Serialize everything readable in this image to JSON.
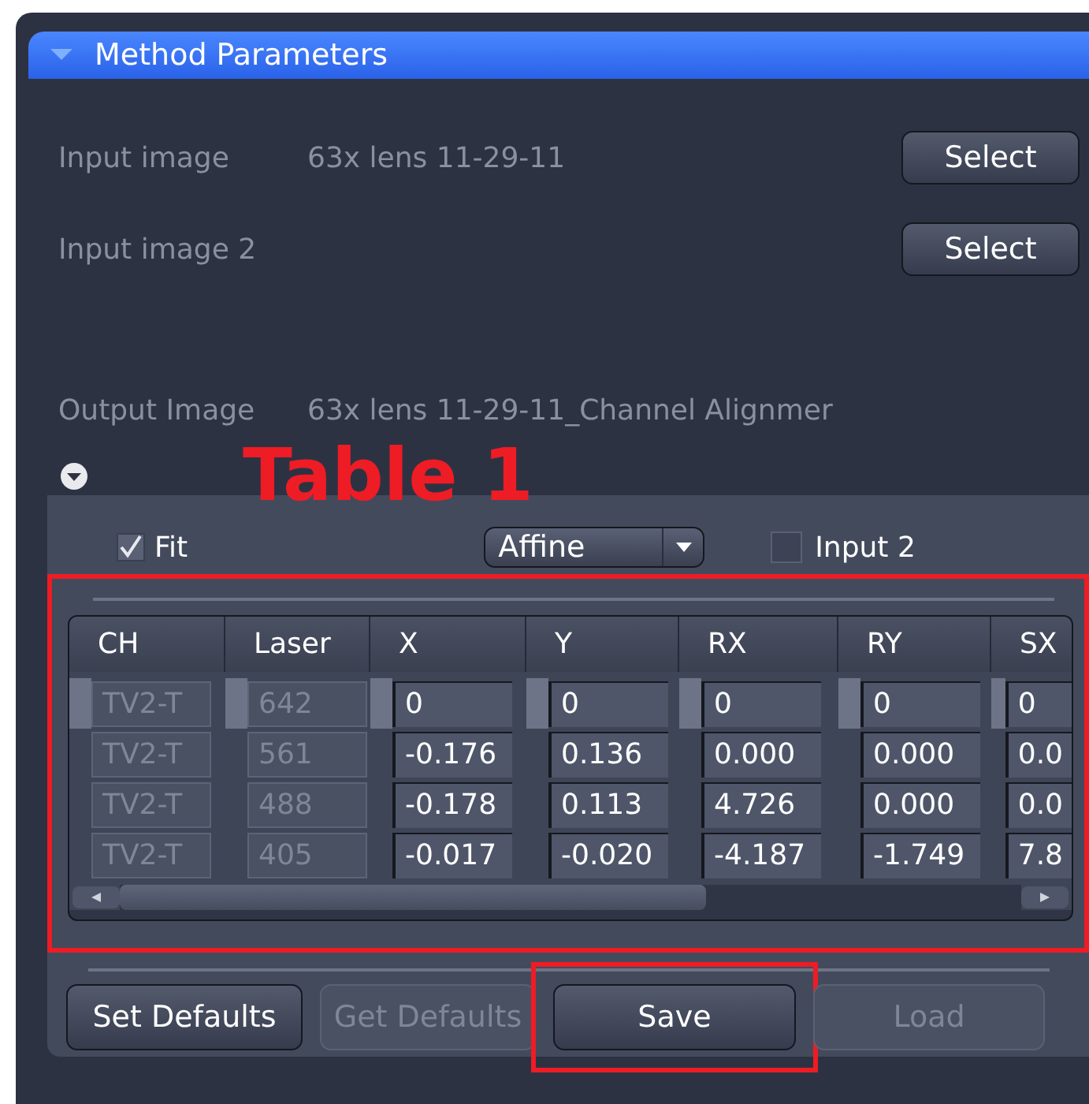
{
  "panel": {
    "title": "Method Parameters",
    "expanded": true
  },
  "fields": [
    {
      "label": "Input image",
      "value": "63x lens 11-29-11",
      "button": "Select"
    },
    {
      "label": "Input image 2",
      "button": "Select"
    },
    {
      "label": "Output Image",
      "value": "63x lens 11-29-11_Channel Alignmer"
    }
  ],
  "table_section": {
    "expanded": true
  },
  "annotation_label": "Table 1",
  "fit": {
    "label": "Fit",
    "checked": true
  },
  "transform": {
    "value": "Affine"
  },
  "input2": {
    "label": "Input 2",
    "checked": false
  },
  "table": {
    "highlighted": true,
    "columns": [
      {
        "label": "CH",
        "editable": false
      },
      {
        "label": "Laser",
        "editable": false
      },
      {
        "label": "X",
        "editable": true
      },
      {
        "label": "Y",
        "editable": true
      },
      {
        "label": "RX",
        "editable": true
      },
      {
        "label": "RY",
        "editable": true
      },
      {
        "label": "SX",
        "editable": true
      }
    ],
    "rows": [
      [
        "TV2-T",
        "642",
        "0",
        "0",
        "0",
        "0",
        "0"
      ],
      [
        "TV2-T",
        "561",
        "-0.176",
        "0.136",
        "0.000",
        "0.000",
        "0.0"
      ],
      [
        "TV2-T",
        "488",
        "-0.178",
        "0.113",
        "4.726",
        "0.000",
        "0.0"
      ],
      [
        "TV2-T",
        "405",
        "-0.017",
        "-0.020",
        "-4.187",
        "-1.749",
        "7.8"
      ]
    ],
    "scroll": {
      "level": 0.65
    }
  },
  "buttons": [
    {
      "label": "Set Defaults",
      "disabled": false,
      "highlighted": false
    },
    {
      "label": "Get Defaults",
      "disabled": true,
      "highlighted": false
    },
    {
      "label": "Save",
      "disabled": false,
      "highlighted": true
    },
    {
      "label": "Load",
      "disabled": true,
      "highlighted": false
    }
  ]
}
